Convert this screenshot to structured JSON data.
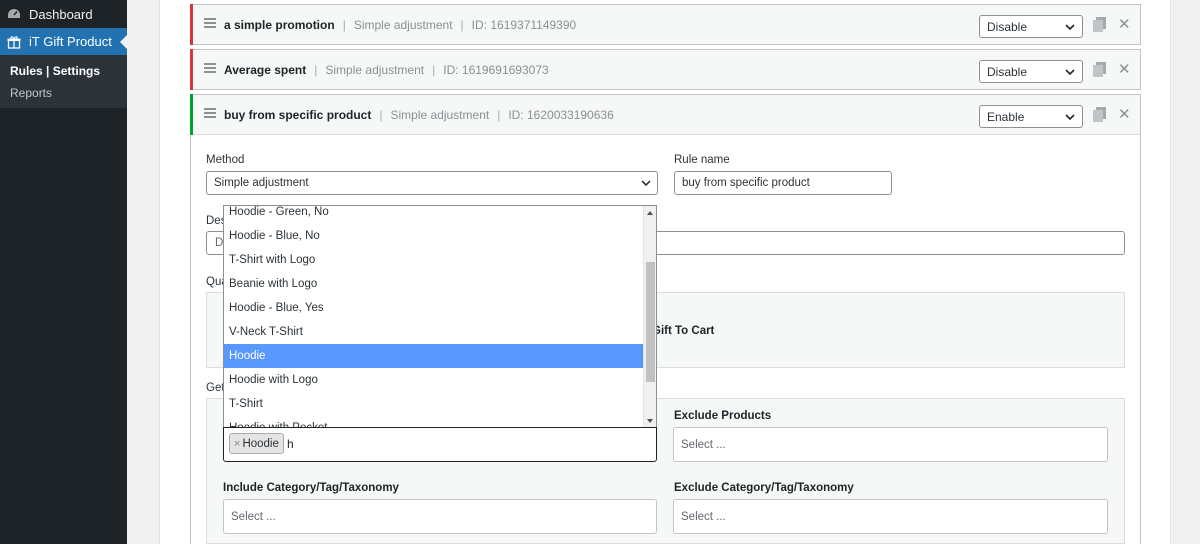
{
  "sidebar": {
    "dashboard": "Dashboard",
    "plugin": "iT Gift Product",
    "rules_settings": "Rules | Settings",
    "reports": "Reports"
  },
  "rules": [
    {
      "name": "a simple promotion",
      "method": "Simple adjustment",
      "id": "ID: 1619371149390",
      "status": "Disable",
      "status_color": "#d63638"
    },
    {
      "name": "Average spent",
      "method": "Simple adjustment",
      "id": "ID: 1619691693073",
      "status": "Disable",
      "status_color": "#d63638"
    },
    {
      "name": "buy from specific product",
      "method": "Simple adjustment",
      "id": "ID: 1620033190636",
      "status": "Enable",
      "status_color": "#00a32a"
    }
  ],
  "form": {
    "method_label": "Method",
    "method_value": "Simple adjustment",
    "rule_name_label": "Rule name",
    "rule_name_value": "buy from specific product",
    "desc_label_visible": "Des",
    "desc_value_visible": "D",
    "qua_label_visible": "Qua",
    "gift_to_cart_visible": "Gift To Cart",
    "get_label_visible": "Get",
    "exclude_products_label": "Exclude Products",
    "exclude_products_placeholder": "Select ...",
    "include_cat_label": "Include Category/Tag/Taxonomy",
    "include_cat_placeholder": "Select ...",
    "exclude_cat_label": "Exclude Category/Tag/Taxonomy",
    "exclude_cat_placeholder": "Select ..."
  },
  "dropdown": {
    "items": [
      "Hoodie - Green, No",
      "Hoodie - Blue, No",
      "T-Shirt with Logo",
      "Beanie with Logo",
      "Hoodie - Blue, Yes",
      "V-Neck T-Shirt",
      "Hoodie",
      "Hoodie with Logo",
      "T-Shirt",
      "Hoodie with Pocket"
    ],
    "active_index": 6
  },
  "product_select": {
    "chip_remove": "×",
    "chip_label": "Hoodie",
    "typed": "h"
  },
  "colors": {
    "sidebar_bg": "#1d2327",
    "active_menu": "#2271b1",
    "highlight": "#5897fb"
  }
}
